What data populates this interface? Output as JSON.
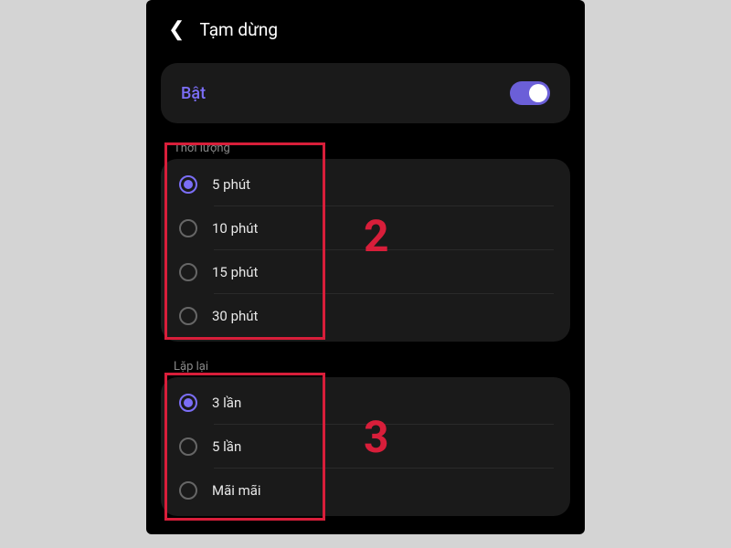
{
  "header": {
    "title": "Tạm dừng"
  },
  "toggle": {
    "label": "Bật",
    "enabled": true
  },
  "sections": {
    "duration": {
      "label": "Thời lượng",
      "options": [
        {
          "label": "5 phút",
          "selected": true
        },
        {
          "label": "10 phút",
          "selected": false
        },
        {
          "label": "15 phút",
          "selected": false
        },
        {
          "label": "30 phút",
          "selected": false
        }
      ]
    },
    "repeat": {
      "label": "Lặp lại",
      "options": [
        {
          "label": "3 lần",
          "selected": true
        },
        {
          "label": "5 lần",
          "selected": false
        },
        {
          "label": "Mãi mãi",
          "selected": false
        }
      ]
    }
  },
  "annotations": {
    "num2": "2",
    "num3": "3"
  },
  "colors": {
    "accent": "#7b6ef6",
    "highlight": "#d81e3a"
  }
}
